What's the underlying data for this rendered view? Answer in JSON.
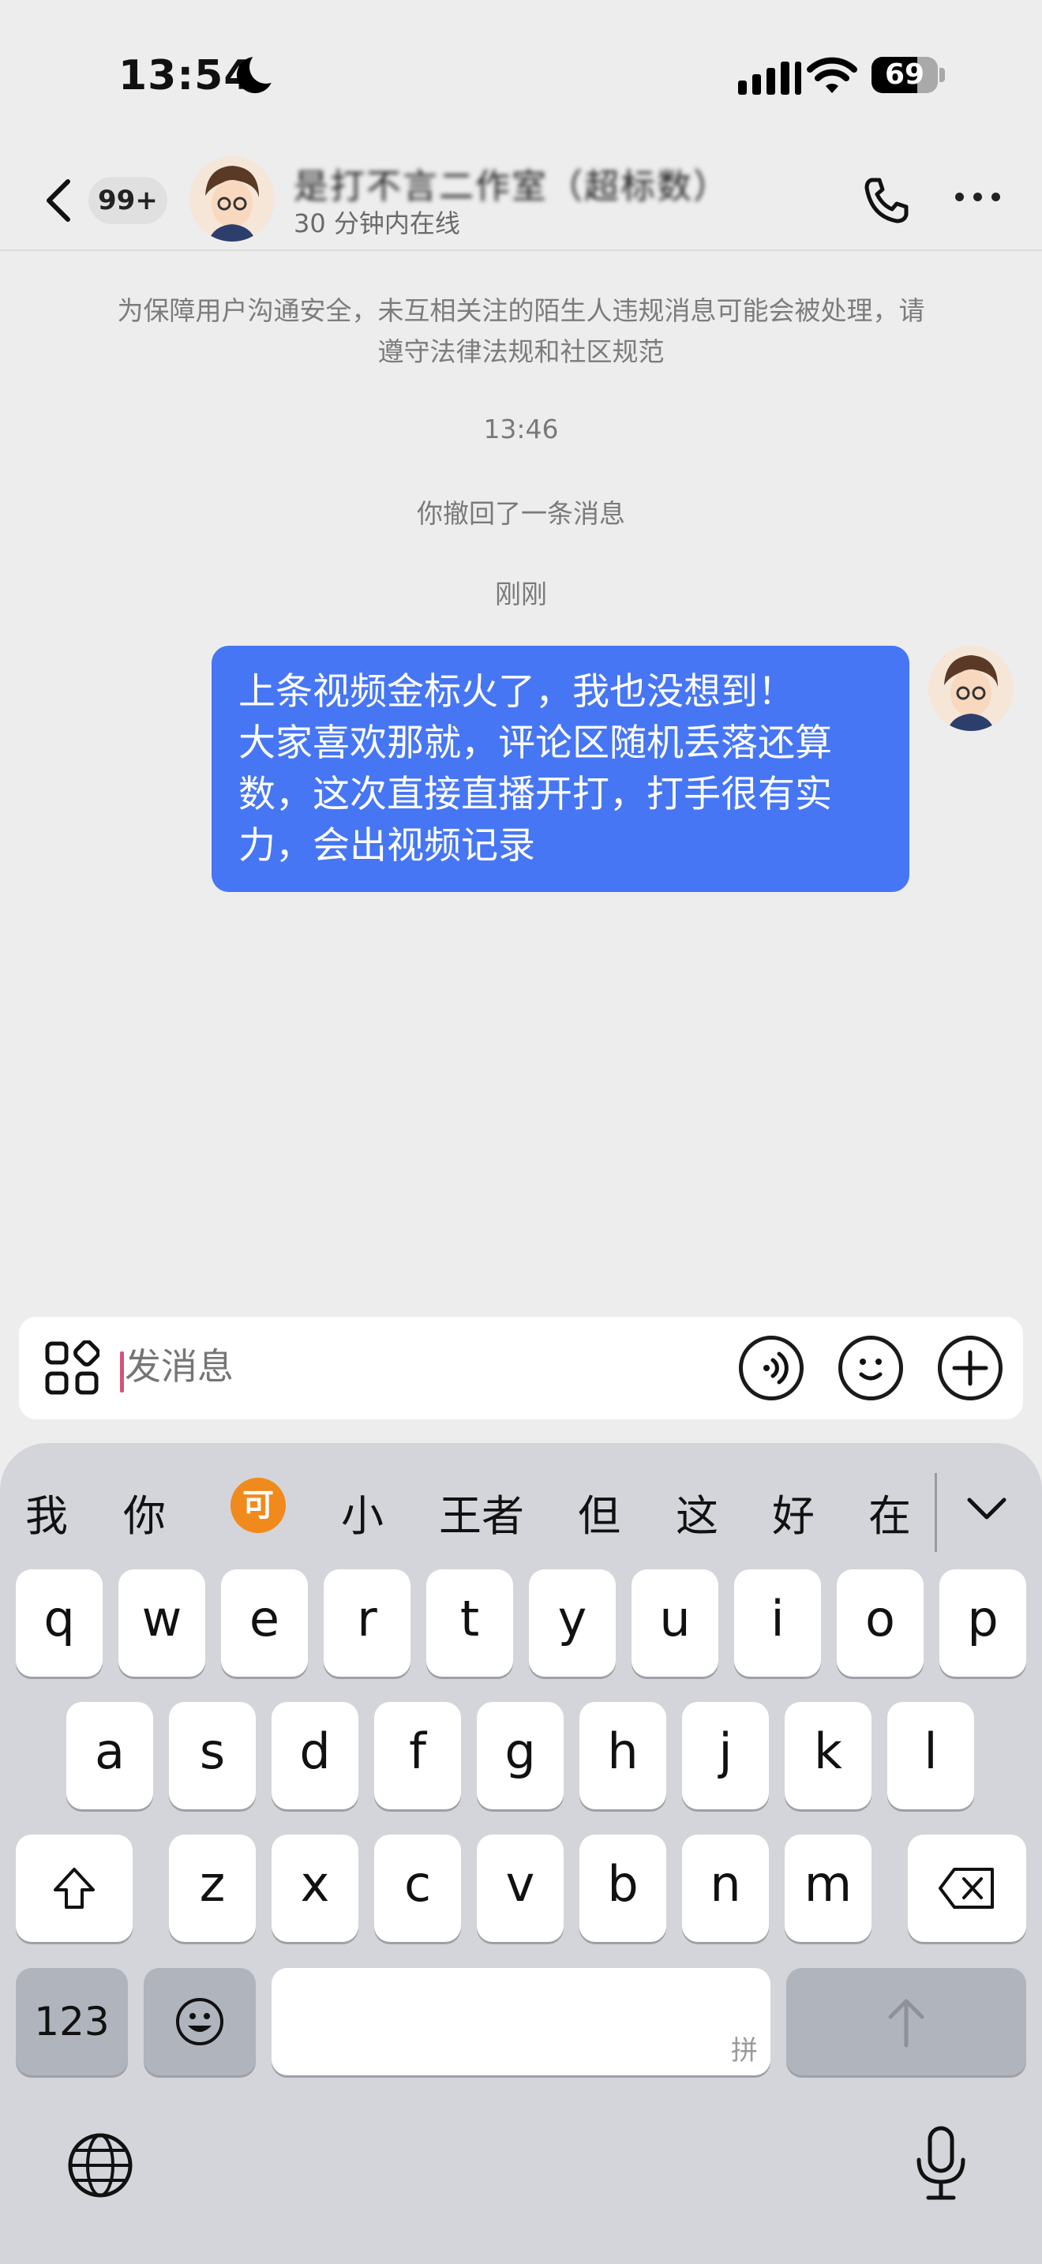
{
  "status_bar": {
    "time": "13:54",
    "battery": "69",
    "battery_level": 0.69
  },
  "header": {
    "unread_badge": "99+",
    "contact_name": "是打不言二作室（超标数）",
    "contact_status": "30 分钟内在线",
    "icons": [
      "back-arrow-icon",
      "phone-icon",
      "more-icon"
    ]
  },
  "messages": {
    "safety_notice": "为保障用户沟通安全，未互相关注的陌生人违规消息可能会被处理，请遵守法律法规和社区规范",
    "timestamp_1": "13:46",
    "recall_notice": "你撤回了一条消息",
    "timestamp_2": "刚刚",
    "bubble_lines": [
      "上条视频金标火了，我也没想到！",
      "大家喜欢那就，评论区随机丢落还算",
      "数，这次直接直播开打，打手很有实",
      "力，会出视频记录"
    ]
  },
  "input_bar": {
    "placeholder": "发消息",
    "icons": [
      "apps-icon",
      "voice-icon",
      "emoji-icon",
      "add-icon"
    ]
  },
  "keyboard": {
    "candidates": [
      "我",
      "你",
      "可",
      "小",
      "王者",
      "但",
      "这",
      "好",
      "在"
    ],
    "row1": [
      "q",
      "w",
      "e",
      "r",
      "t",
      "y",
      "u",
      "i",
      "o",
      "p"
    ],
    "row2": [
      "a",
      "s",
      "d",
      "f",
      "g",
      "h",
      "j",
      "k",
      "l"
    ],
    "row3": [
      "z",
      "x",
      "c",
      "v",
      "b",
      "n",
      "m"
    ],
    "num_key": "123",
    "space_hint": "拼",
    "colors": {
      "bubble": "#4676f3",
      "candidate_highlight": "#f08a1c"
    }
  }
}
